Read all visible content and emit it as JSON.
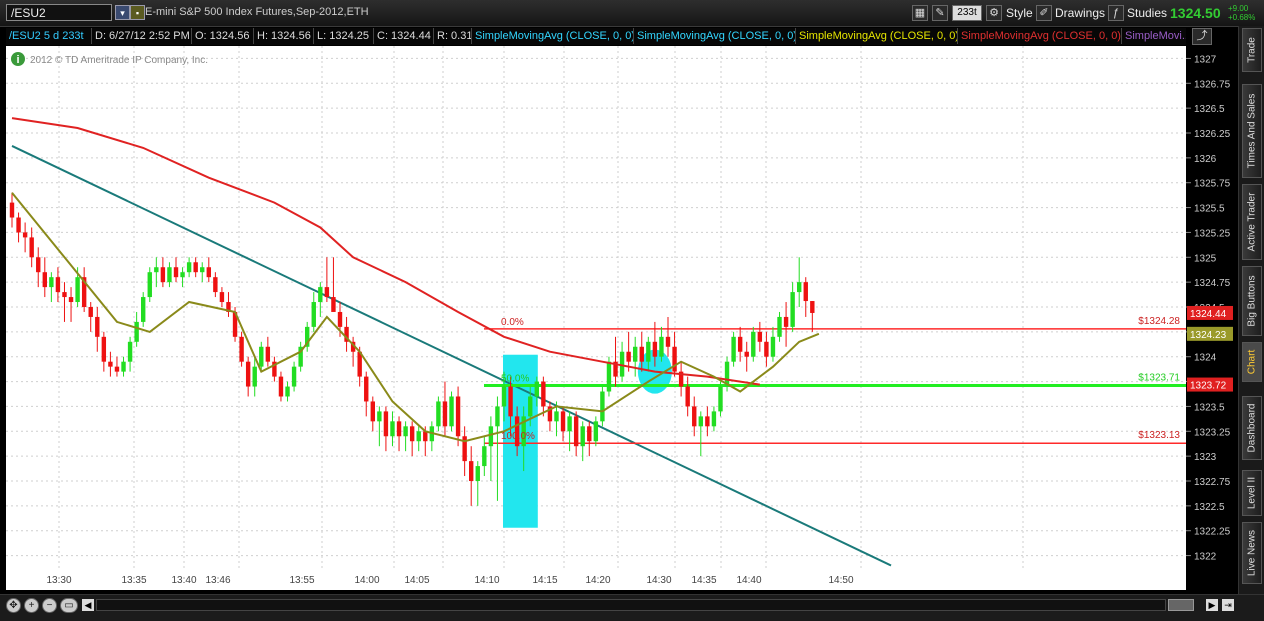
{
  "header": {
    "symbol": "/ESU2",
    "description": "E-mini S&P 500 Index Futures,Sep-2012,ETH",
    "aggregation": "233t",
    "style_label": "Style",
    "drawings_label": "Drawings",
    "studies_label": "Studies",
    "last_price": "1324.50",
    "change": "+9.00",
    "change_pct": "+0.68%"
  },
  "infobar": {
    "title": "/ESU2 5 d 233t",
    "date": "D: 6/27/12 2:52 PM",
    "open": "O: 1324.56",
    "high": "H: 1324.56",
    "low": "L: 1324.25",
    "close": "C: 1324.44",
    "range": "R: 0.31",
    "studies": [
      {
        "label": "SimpleMovingAvg (CLOSE, 0, 0)",
        "color": "#33d6ff"
      },
      {
        "label": "SimpleMovingAvg (CLOSE, 0, 0)",
        "color": "#33d6ff"
      },
      {
        "label": "SimpleMovingAvg (CLOSE, 0, 0)",
        "color": "#e6e600"
      },
      {
        "label": "SimpleMovingAvg (CLOSE, 0, 0)",
        "color": "#e03030"
      },
      {
        "label": "SimpleMovi...",
        "color": "#9a5ec8"
      }
    ]
  },
  "copyright": "2012 © TD Ameritrade IP Company, Inc.",
  "sidebar": [
    "Trade",
    "Times And Sales",
    "Active Trader",
    "Big Buttons",
    "Chart",
    "Dashboard",
    "Level II",
    "Live News"
  ],
  "chart_data": {
    "type": "candlestick",
    "x_ticks": [
      "13:30",
      "13:35",
      "13:40",
      "13:46",
      "13:55",
      "14:00",
      "14:05",
      "14:10",
      "14:15",
      "14:20",
      "14:30",
      "14:35",
      "14:40",
      "14:50"
    ],
    "y_ticks": [
      1327,
      1326.75,
      1326.5,
      1326.25,
      1326,
      1325.75,
      1325.5,
      1325.25,
      1325,
      1324.75,
      1324.5,
      1324.25,
      1324,
      1323.75,
      1323.5,
      1323.25,
      1323,
      1322.75,
      1322.5,
      1322.25,
      1322
    ],
    "ylim": [
      1321.875,
      1327.125
    ],
    "price_labels": [
      {
        "text": "1324.44",
        "value": 1324.44,
        "color": "#e02020"
      },
      {
        "text": "1324.23",
        "value": 1324.23,
        "color": "#9a9a2a"
      },
      {
        "text": "1323.72",
        "value": 1323.72,
        "color": "#e02020"
      }
    ],
    "fibonacci": [
      {
        "label": "0.0%",
        "price_label": "$1324.28",
        "value": 1324.28,
        "color": "#ff2a2a"
      },
      {
        "label": "50.0%",
        "price_label": "$1323.71",
        "value": 1323.71,
        "color": "#22ee22"
      },
      {
        "label": "100.0%",
        "price_label": "$1323.13",
        "value": 1323.13,
        "color": "#ff2a2a"
      }
    ],
    "colors": {
      "up": "#22dd22",
      "down": "#ee1111",
      "sma_slow": "#e02222",
      "sma_fast": "#8a8a1a",
      "trendline": "#1a7a7a",
      "highlight": "#22e6ee",
      "grid": "#cfcfcf"
    },
    "bars": [
      {
        "o": 1325.55,
        "h": 1325.65,
        "l": 1325.3,
        "c": 1325.4
      },
      {
        "o": 1325.4,
        "h": 1325.45,
        "l": 1325.15,
        "c": 1325.25
      },
      {
        "o": 1325.25,
        "h": 1325.35,
        "l": 1325.05,
        "c": 1325.2
      },
      {
        "o": 1325.2,
        "h": 1325.3,
        "l": 1324.9,
        "c": 1325.0
      },
      {
        "o": 1325.0,
        "h": 1325.1,
        "l": 1324.7,
        "c": 1324.85
      },
      {
        "o": 1324.85,
        "h": 1325.0,
        "l": 1324.6,
        "c": 1324.7
      },
      {
        "o": 1324.7,
        "h": 1324.85,
        "l": 1324.55,
        "c": 1324.8
      },
      {
        "o": 1324.8,
        "h": 1324.9,
        "l": 1324.55,
        "c": 1324.65
      },
      {
        "o": 1324.65,
        "h": 1324.75,
        "l": 1324.35,
        "c": 1324.6
      },
      {
        "o": 1324.6,
        "h": 1324.7,
        "l": 1324.35,
        "c": 1324.55
      },
      {
        "o": 1324.55,
        "h": 1324.9,
        "l": 1324.5,
        "c": 1324.8
      },
      {
        "o": 1324.8,
        "h": 1324.9,
        "l": 1324.45,
        "c": 1324.5
      },
      {
        "o": 1324.5,
        "h": 1324.55,
        "l": 1324.25,
        "c": 1324.4
      },
      {
        "o": 1324.4,
        "h": 1324.5,
        "l": 1324.05,
        "c": 1324.2
      },
      {
        "o": 1324.2,
        "h": 1324.25,
        "l": 1323.85,
        "c": 1323.95
      },
      {
        "o": 1323.95,
        "h": 1324.05,
        "l": 1323.8,
        "c": 1323.9
      },
      {
        "o": 1323.9,
        "h": 1324.0,
        "l": 1323.8,
        "c": 1323.85
      },
      {
        "o": 1323.85,
        "h": 1324.0,
        "l": 1323.8,
        "c": 1323.95
      },
      {
        "o": 1323.95,
        "h": 1324.2,
        "l": 1323.85,
        "c": 1324.15
      },
      {
        "o": 1324.15,
        "h": 1324.45,
        "l": 1324.1,
        "c": 1324.35
      },
      {
        "o": 1324.35,
        "h": 1324.65,
        "l": 1324.3,
        "c": 1324.6
      },
      {
        "o": 1324.6,
        "h": 1324.9,
        "l": 1324.55,
        "c": 1324.85
      },
      {
        "o": 1324.85,
        "h": 1325.0,
        "l": 1324.7,
        "c": 1324.9
      },
      {
        "o": 1324.9,
        "h": 1325.0,
        "l": 1324.7,
        "c": 1324.75
      },
      {
        "o": 1324.75,
        "h": 1324.95,
        "l": 1324.7,
        "c": 1324.9
      },
      {
        "o": 1324.9,
        "h": 1325.0,
        "l": 1324.75,
        "c": 1324.8
      },
      {
        "o": 1324.8,
        "h": 1324.9,
        "l": 1324.7,
        "c": 1324.85
      },
      {
        "o": 1324.85,
        "h": 1325.0,
        "l": 1324.8,
        "c": 1324.95
      },
      {
        "o": 1324.95,
        "h": 1325.0,
        "l": 1324.8,
        "c": 1324.85
      },
      {
        "o": 1324.85,
        "h": 1324.95,
        "l": 1324.75,
        "c": 1324.9
      },
      {
        "o": 1324.9,
        "h": 1325.0,
        "l": 1324.75,
        "c": 1324.8
      },
      {
        "o": 1324.8,
        "h": 1324.85,
        "l": 1324.6,
        "c": 1324.65
      },
      {
        "o": 1324.65,
        "h": 1324.7,
        "l": 1324.5,
        "c": 1324.55
      },
      {
        "o": 1324.55,
        "h": 1324.65,
        "l": 1324.4,
        "c": 1324.45
      },
      {
        "o": 1324.45,
        "h": 1324.5,
        "l": 1324.15,
        "c": 1324.2
      },
      {
        "o": 1324.2,
        "h": 1324.25,
        "l": 1323.9,
        "c": 1323.95
      },
      {
        "o": 1323.95,
        "h": 1324.0,
        "l": 1323.6,
        "c": 1323.7
      },
      {
        "o": 1323.7,
        "h": 1324.0,
        "l": 1323.6,
        "c": 1323.9
      },
      {
        "o": 1323.9,
        "h": 1324.15,
        "l": 1323.85,
        "c": 1324.1
      },
      {
        "o": 1324.1,
        "h": 1324.2,
        "l": 1323.9,
        "c": 1323.95
      },
      {
        "o": 1323.95,
        "h": 1324.0,
        "l": 1323.75,
        "c": 1323.8
      },
      {
        "o": 1323.8,
        "h": 1323.85,
        "l": 1323.55,
        "c": 1323.6
      },
      {
        "o": 1323.6,
        "h": 1323.75,
        "l": 1323.55,
        "c": 1323.7
      },
      {
        "o": 1323.7,
        "h": 1323.95,
        "l": 1323.65,
        "c": 1323.9
      },
      {
        "o": 1323.9,
        "h": 1324.15,
        "l": 1323.85,
        "c": 1324.1
      },
      {
        "o": 1324.1,
        "h": 1324.35,
        "l": 1324.05,
        "c": 1324.3
      },
      {
        "o": 1324.3,
        "h": 1324.65,
        "l": 1324.25,
        "c": 1324.55
      },
      {
        "o": 1324.55,
        "h": 1324.75,
        "l": 1324.4,
        "c": 1324.7
      },
      {
        "o": 1324.7,
        "h": 1325.0,
        "l": 1324.55,
        "c": 1324.6
      },
      {
        "o": 1324.6,
        "h": 1325.0,
        "l": 1324.5,
        "c": 1324.45
      },
      {
        "o": 1324.45,
        "h": 1324.55,
        "l": 1324.2,
        "c": 1324.3
      },
      {
        "o": 1324.3,
        "h": 1324.4,
        "l": 1324.05,
        "c": 1324.15
      },
      {
        "o": 1324.15,
        "h": 1324.2,
        "l": 1323.9,
        "c": 1324.05
      },
      {
        "o": 1324.05,
        "h": 1324.1,
        "l": 1323.7,
        "c": 1323.8
      },
      {
        "o": 1323.8,
        "h": 1323.85,
        "l": 1323.4,
        "c": 1323.55
      },
      {
        "o": 1323.55,
        "h": 1323.6,
        "l": 1323.25,
        "c": 1323.35
      },
      {
        "o": 1323.35,
        "h": 1323.5,
        "l": 1323.1,
        "c": 1323.45
      },
      {
        "o": 1323.45,
        "h": 1323.5,
        "l": 1323.05,
        "c": 1323.2
      },
      {
        "o": 1323.2,
        "h": 1323.45,
        "l": 1323.1,
        "c": 1323.35
      },
      {
        "o": 1323.35,
        "h": 1323.4,
        "l": 1323.05,
        "c": 1323.2
      },
      {
        "o": 1323.2,
        "h": 1323.35,
        "l": 1323.05,
        "c": 1323.3
      },
      {
        "o": 1323.3,
        "h": 1323.35,
        "l": 1323.0,
        "c": 1323.15
      },
      {
        "o": 1323.15,
        "h": 1323.3,
        "l": 1323.05,
        "c": 1323.25
      },
      {
        "o": 1323.25,
        "h": 1323.3,
        "l": 1323.0,
        "c": 1323.15
      },
      {
        "o": 1323.15,
        "h": 1323.35,
        "l": 1323.05,
        "c": 1323.3
      },
      {
        "o": 1323.3,
        "h": 1323.6,
        "l": 1323.25,
        "c": 1323.55
      },
      {
        "o": 1323.55,
        "h": 1323.75,
        "l": 1323.2,
        "c": 1323.3
      },
      {
        "o": 1323.3,
        "h": 1323.65,
        "l": 1323.25,
        "c": 1323.6
      },
      {
        "o": 1323.6,
        "h": 1323.7,
        "l": 1323.1,
        "c": 1323.2
      },
      {
        "o": 1323.2,
        "h": 1323.3,
        "l": 1322.8,
        "c": 1322.95
      },
      {
        "o": 1322.95,
        "h": 1323.1,
        "l": 1322.5,
        "c": 1322.75
      },
      {
        "o": 1322.75,
        "h": 1322.95,
        "l": 1322.5,
        "c": 1322.9
      },
      {
        "o": 1322.9,
        "h": 1323.2,
        "l": 1322.8,
        "c": 1323.1
      },
      {
        "o": 1323.1,
        "h": 1323.4,
        "l": 1322.75,
        "c": 1323.3
      },
      {
        "o": 1323.3,
        "h": 1323.6,
        "l": 1322.55,
        "c": 1323.5
      },
      {
        "o": 1323.5,
        "h": 1323.85,
        "l": 1323.35,
        "c": 1323.7
      },
      {
        "o": 1323.7,
        "h": 1323.8,
        "l": 1323.2,
        "c": 1323.4
      },
      {
        "o": 1323.4,
        "h": 1323.5,
        "l": 1323.0,
        "c": 1323.1
      },
      {
        "o": 1323.1,
        "h": 1323.5,
        "l": 1322.85,
        "c": 1323.4
      },
      {
        "o": 1323.4,
        "h": 1323.7,
        "l": 1323.3,
        "c": 1323.6
      },
      {
        "o": 1323.6,
        "h": 1323.8,
        "l": 1323.5,
        "c": 1323.75
      },
      {
        "o": 1323.75,
        "h": 1323.8,
        "l": 1323.4,
        "c": 1323.5
      },
      {
        "o": 1323.5,
        "h": 1323.55,
        "l": 1323.25,
        "c": 1323.35
      },
      {
        "o": 1323.35,
        "h": 1323.55,
        "l": 1323.2,
        "c": 1323.45
      },
      {
        "o": 1323.45,
        "h": 1323.5,
        "l": 1323.15,
        "c": 1323.25
      },
      {
        "o": 1323.25,
        "h": 1323.45,
        "l": 1323.05,
        "c": 1323.4
      },
      {
        "o": 1323.4,
        "h": 1323.45,
        "l": 1323.0,
        "c": 1323.1
      },
      {
        "o": 1323.1,
        "h": 1323.35,
        "l": 1322.95,
        "c": 1323.3
      },
      {
        "o": 1323.3,
        "h": 1323.35,
        "l": 1323.0,
        "c": 1323.15
      },
      {
        "o": 1323.15,
        "h": 1323.4,
        "l": 1323.1,
        "c": 1323.35
      },
      {
        "o": 1323.35,
        "h": 1323.7,
        "l": 1323.3,
        "c": 1323.65
      },
      {
        "o": 1323.65,
        "h": 1324.0,
        "l": 1323.6,
        "c": 1323.95
      },
      {
        "o": 1323.95,
        "h": 1324.2,
        "l": 1323.7,
        "c": 1323.8
      },
      {
        "o": 1323.8,
        "h": 1324.15,
        "l": 1323.75,
        "c": 1324.05
      },
      {
        "o": 1324.05,
        "h": 1324.25,
        "l": 1323.85,
        "c": 1323.95
      },
      {
        "o": 1323.95,
        "h": 1324.2,
        "l": 1323.8,
        "c": 1324.1
      },
      {
        "o": 1324.1,
        "h": 1324.25,
        "l": 1323.85,
        "c": 1323.95
      },
      {
        "o": 1323.95,
        "h": 1324.2,
        "l": 1323.85,
        "c": 1324.15
      },
      {
        "o": 1324.15,
        "h": 1324.35,
        "l": 1323.9,
        "c": 1324.0
      },
      {
        "o": 1324.0,
        "h": 1324.3,
        "l": 1323.95,
        "c": 1324.2
      },
      {
        "o": 1324.2,
        "h": 1324.4,
        "l": 1324.0,
        "c": 1324.1
      },
      {
        "o": 1324.1,
        "h": 1324.25,
        "l": 1323.8,
        "c": 1323.85
      },
      {
        "o": 1323.85,
        "h": 1323.95,
        "l": 1323.6,
        "c": 1323.7
      },
      {
        "o": 1323.7,
        "h": 1323.8,
        "l": 1323.4,
        "c": 1323.5
      },
      {
        "o": 1323.5,
        "h": 1323.6,
        "l": 1323.2,
        "c": 1323.3
      },
      {
        "o": 1323.3,
        "h": 1323.45,
        "l": 1323.0,
        "c": 1323.4
      },
      {
        "o": 1323.4,
        "h": 1323.5,
        "l": 1323.2,
        "c": 1323.3
      },
      {
        "o": 1323.3,
        "h": 1323.5,
        "l": 1323.25,
        "c": 1323.45
      },
      {
        "o": 1323.45,
        "h": 1323.75,
        "l": 1323.4,
        "c": 1323.7
      },
      {
        "o": 1323.7,
        "h": 1324.0,
        "l": 1323.65,
        "c": 1323.95
      },
      {
        "o": 1323.95,
        "h": 1324.25,
        "l": 1323.9,
        "c": 1324.2
      },
      {
        "o": 1324.2,
        "h": 1324.3,
        "l": 1323.95,
        "c": 1324.05
      },
      {
        "o": 1324.05,
        "h": 1324.15,
        "l": 1323.85,
        "c": 1324.0
      },
      {
        "o": 1324.0,
        "h": 1324.3,
        "l": 1323.95,
        "c": 1324.25
      },
      {
        "o": 1324.25,
        "h": 1324.35,
        "l": 1324.05,
        "c": 1324.15
      },
      {
        "o": 1324.15,
        "h": 1324.25,
        "l": 1323.9,
        "c": 1324.0
      },
      {
        "o": 1324.0,
        "h": 1324.3,
        "l": 1323.95,
        "c": 1324.2
      },
      {
        "o": 1324.2,
        "h": 1324.45,
        "l": 1324.15,
        "c": 1324.4
      },
      {
        "o": 1324.4,
        "h": 1324.55,
        "l": 1324.1,
        "c": 1324.3
      },
      {
        "o": 1324.3,
        "h": 1324.75,
        "l": 1324.25,
        "c": 1324.65
      },
      {
        "o": 1324.65,
        "h": 1325.0,
        "l": 1324.5,
        "c": 1324.75
      },
      {
        "o": 1324.75,
        "h": 1324.8,
        "l": 1324.4,
        "c": 1324.56
      },
      {
        "o": 1324.56,
        "h": 1324.56,
        "l": 1324.25,
        "c": 1324.44
      }
    ],
    "sma_fast": [
      [
        0,
        1325.65
      ],
      [
        8,
        1325.0
      ],
      [
        16,
        1324.35
      ],
      [
        21,
        1324.25
      ],
      [
        27,
        1324.55
      ],
      [
        34,
        1324.45
      ],
      [
        38,
        1323.85
      ],
      [
        44,
        1324.05
      ],
      [
        48,
        1324.4
      ],
      [
        53,
        1324.05
      ],
      [
        58,
        1323.55
      ],
      [
        63,
        1323.25
      ],
      [
        69,
        1323.15
      ],
      [
        75,
        1323.25
      ],
      [
        83,
        1323.5
      ],
      [
        90,
        1323.45
      ],
      [
        97,
        1323.75
      ],
      [
        102,
        1323.95
      ],
      [
        107,
        1323.8
      ],
      [
        111,
        1323.65
      ],
      [
        116,
        1323.9
      ],
      [
        120,
        1324.15
      ],
      [
        123,
        1324.23
      ]
    ],
    "sma_slow": [
      [
        0,
        1326.4
      ],
      [
        10,
        1326.3
      ],
      [
        20,
        1326.1
      ],
      [
        30,
        1325.8
      ],
      [
        40,
        1325.55
      ],
      [
        47,
        1325.3
      ],
      [
        52,
        1325.0
      ],
      [
        60,
        1324.75
      ],
      [
        68,
        1324.45
      ],
      [
        75,
        1324.2
      ],
      [
        82,
        1324.05
      ],
      [
        90,
        1323.95
      ],
      [
        98,
        1323.85
      ],
      [
        106,
        1323.8
      ],
      [
        114,
        1323.72
      ]
    ],
    "trendline": [
      [
        1326.12,
        0
      ],
      [
        1321.9,
        134
      ]
    ],
    "highlight_box": {
      "bar_from": 75,
      "bar_to": 80,
      "from": 1322.28,
      "to": 1324.02
    },
    "highlight_dot": {
      "bar": 98,
      "value": 1323.85
    }
  }
}
